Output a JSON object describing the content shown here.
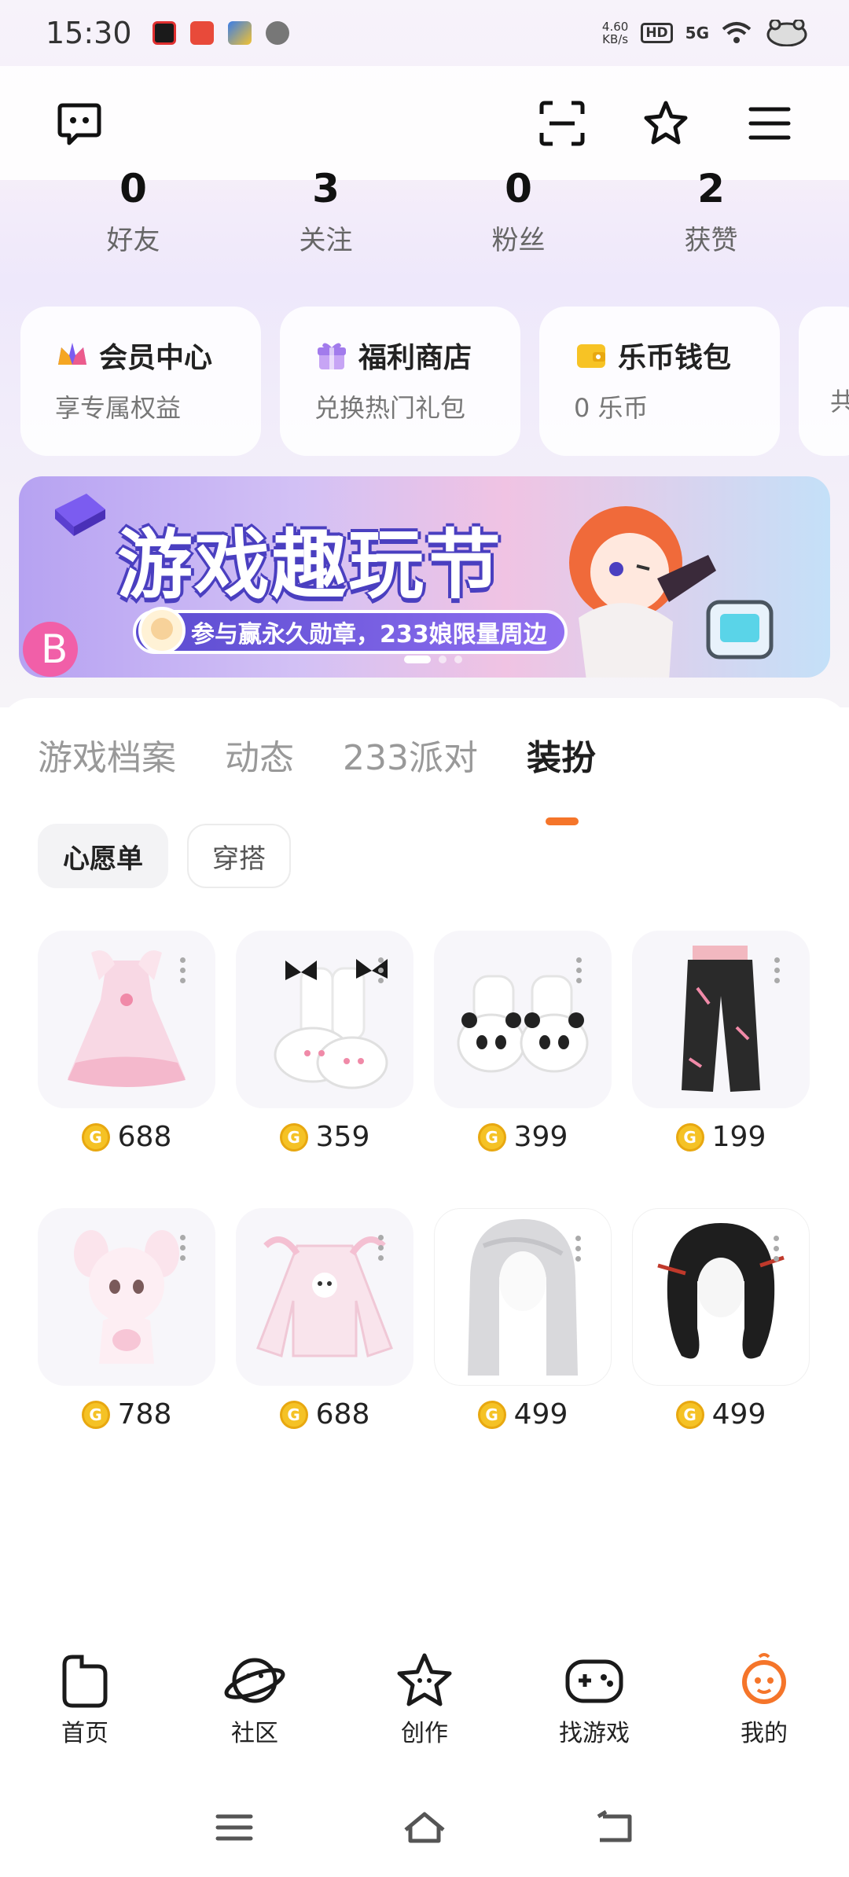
{
  "status_bar": {
    "time": "15:30",
    "net_speed": "4.60\nKB/s",
    "hd": "HD",
    "signal": "5G"
  },
  "stats": [
    {
      "value": "0",
      "label": "好友"
    },
    {
      "value": "3",
      "label": "关注"
    },
    {
      "value": "0",
      "label": "粉丝"
    },
    {
      "value": "2",
      "label": "获赞"
    }
  ],
  "cards": [
    {
      "title": "会员中心",
      "subtitle": "享专属权益"
    },
    {
      "title": "福利商店",
      "subtitle": "兑换热门礼包"
    },
    {
      "title": "乐币钱包",
      "subtitle": "0 乐币"
    },
    {
      "title": "",
      "subtitle": "共"
    }
  ],
  "banner": {
    "title": "游戏趣玩节",
    "subtitle": "参与赢永久勋章，233娘限量周边"
  },
  "tabs": [
    "游戏档案",
    "动态",
    "233派对",
    "装扮"
  ],
  "chips": [
    "心愿单",
    "穿搭"
  ],
  "items": [
    {
      "price": "688",
      "icon": "dress-icon"
    },
    {
      "price": "359",
      "icon": "shoes-icon"
    },
    {
      "price": "399",
      "icon": "panda-slippers-icon"
    },
    {
      "price": "199",
      "icon": "pants-icon"
    },
    {
      "price": "788",
      "icon": "bunny-costume-icon"
    },
    {
      "price": "688",
      "icon": "jacket-icon"
    },
    {
      "price": "499",
      "icon": "white-hair-icon"
    },
    {
      "price": "499",
      "icon": "black-hair-icon"
    }
  ],
  "bottom_nav": [
    {
      "label": "首页"
    },
    {
      "label": "社区"
    },
    {
      "label": "创作"
    },
    {
      "label": "找游戏"
    },
    {
      "label": "我的"
    }
  ],
  "colors": {
    "accent": "#f5752a",
    "coin": "#f5c225"
  }
}
